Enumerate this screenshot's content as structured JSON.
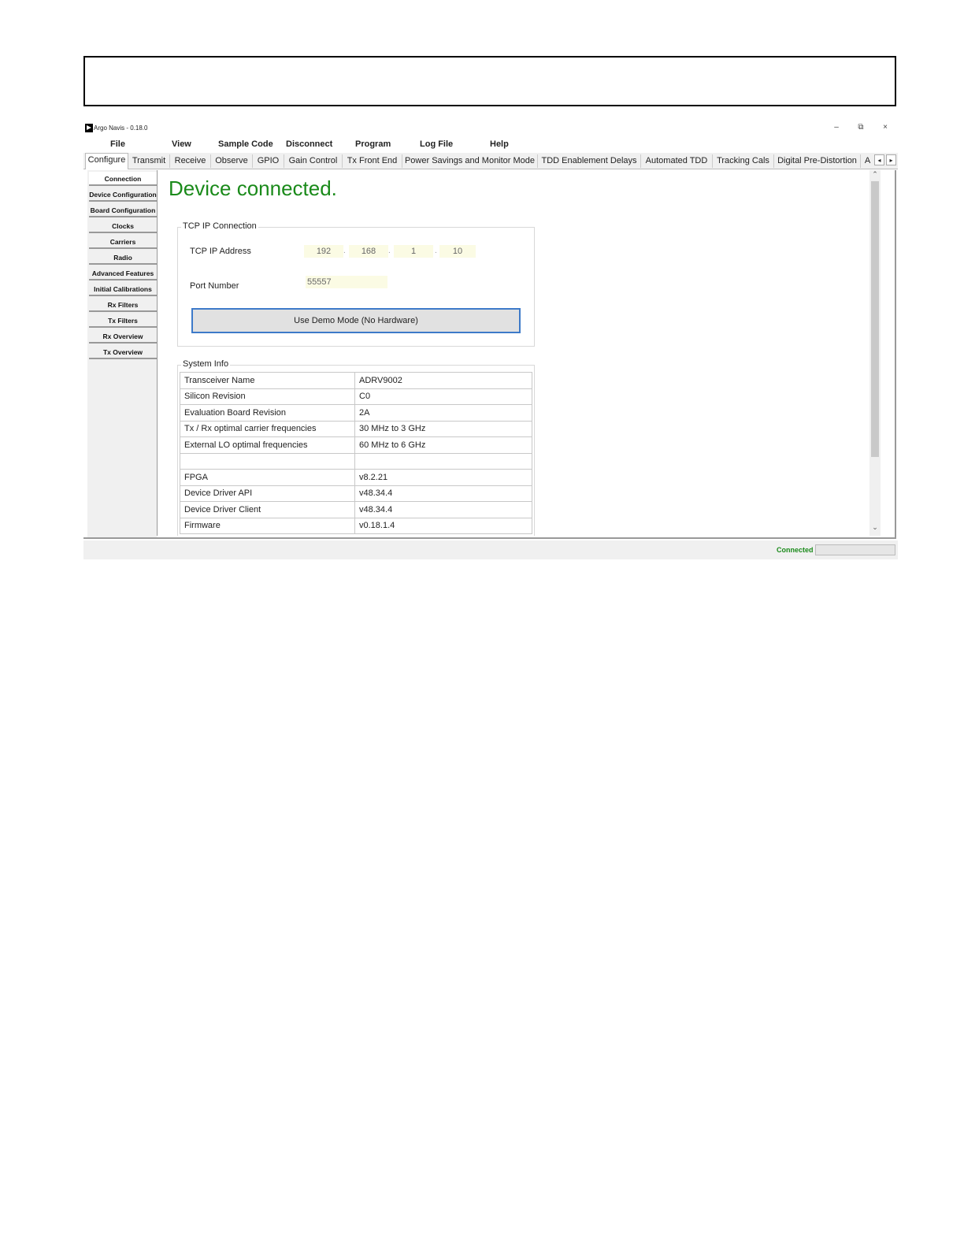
{
  "window": {
    "title": "Argo Navis - 0.18.0",
    "controls": {
      "minimize": "–",
      "restore": "⧉",
      "close": "×"
    }
  },
  "menu": [
    "File",
    "View",
    "Sample Code",
    "Disconnect",
    "Program",
    "Log File",
    "Help"
  ],
  "tabs": [
    "Configure",
    "Transmit",
    "Receive",
    "Observe",
    "GPIO",
    "Gain Control",
    "Tx Front End",
    "Power Savings and Monitor Mode",
    "TDD Enablement Delays",
    "Automated TDD",
    "Tracking Cals",
    "Digital Pre-Distortion",
    "A"
  ],
  "active_tab": "Configure",
  "tab_scroll": {
    "left": "◂",
    "right": "▸"
  },
  "sidenav": [
    "Connection",
    "Device Configuration",
    "Board Configuration",
    "Clocks",
    "Carriers",
    "Radio",
    "Advanced Features",
    "Initial Calibrations",
    "Rx Filters",
    "Tx Filters",
    "Rx Overview",
    "Tx Overview"
  ],
  "active_sidenav": "Connection",
  "main": {
    "headline": "Device connected.",
    "tcp_group": {
      "legend": "TCP IP Connection",
      "ip_label": "TCP IP Address",
      "ip_octets": [
        "192",
        "168",
        "1",
        "10"
      ],
      "ip_separator": ".",
      "port_label": "Port Number",
      "port_value": "55557",
      "demo_button": "Use Demo Mode (No Hardware)"
    },
    "system_info": {
      "legend": "System Info",
      "rows": [
        [
          "Transceiver Name",
          "ADRV9002"
        ],
        [
          "Silicon Revision",
          "C0"
        ],
        [
          "Evaluation Board Revision",
          "2A"
        ],
        [
          "Tx / Rx optimal carrier frequencies",
          "30 MHz to 3 GHz"
        ],
        [
          "External LO optimal frequencies",
          "60 MHz to 6 GHz"
        ],
        [
          "",
          ""
        ],
        [
          "FPGA",
          "v8.2.21"
        ],
        [
          "Device Driver API",
          "v48.34.4"
        ],
        [
          "Device Driver Client",
          "v48.34.4"
        ],
        [
          "Firmware",
          "v0.18.1.4"
        ]
      ]
    }
  },
  "scrollbar": {
    "up": "⌃",
    "down": "⌄"
  },
  "status": {
    "text": "Connected"
  },
  "colors": {
    "connected_green": "#1a8a1a",
    "field_bg": "#fbfbe4",
    "button_border": "#3d7ac9"
  }
}
